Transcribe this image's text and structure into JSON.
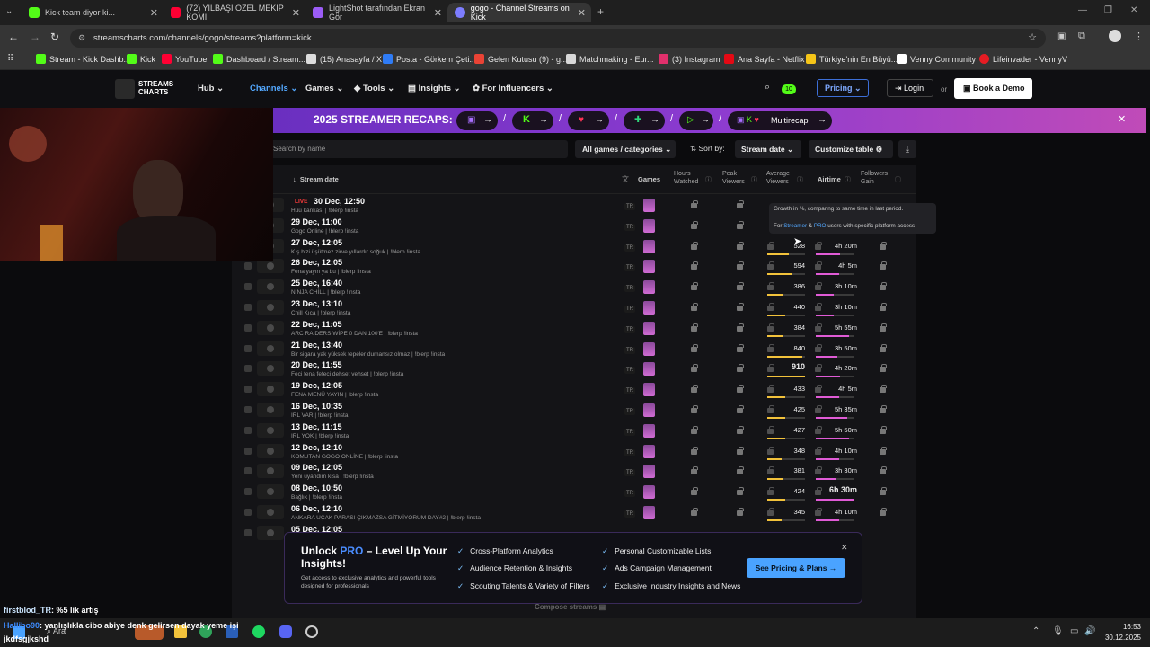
{
  "browser": {
    "tabs": [
      {
        "title": "Kick team diyor ki...",
        "color": "#53fc18"
      },
      {
        "title": "(72) YILBAŞI ÖZEL MEKİP KOMİ",
        "color": "#ff0033"
      },
      {
        "title": "LightShot tarafından Ekran Gör",
        "color": "#9b5cf6"
      },
      {
        "title": "gogo - Channel Streams on Kick",
        "color": "#7d7dff"
      }
    ],
    "url": "streamscharts.com/channels/gogo/streams?platform=kick",
    "bookmarks": [
      {
        "label": "Stream - Kick Dashb...",
        "color": "#53fc18"
      },
      {
        "label": "Kick",
        "color": "#53fc18"
      },
      {
        "label": "YouTube",
        "color": "#ff0033"
      },
      {
        "label": "Dashboard / Stream...",
        "color": "#53fc18"
      },
      {
        "label": "(15) Anasayfa / X",
        "color": "#dddddd"
      },
      {
        "label": "Posta - Görkem Çeti...",
        "color": "#2f7cf6"
      },
      {
        "label": "Gelen Kutusu (9) - g...",
        "color": "#ea4335"
      },
      {
        "label": "Matchmaking - Eur...",
        "color": "#d8d8d8"
      },
      {
        "label": "(3) Instagram",
        "color": "#e1306c"
      },
      {
        "label": "Ana Sayfa - Netflix",
        "color": "#e50914"
      },
      {
        "label": "Türkiye'nin En Büyü...",
        "color": "#f5c518"
      },
      {
        "label": "Venny Community",
        "color": "#ffffff"
      },
      {
        "label": "Lifeinvader - VennyV",
        "color": "#e51c23"
      }
    ]
  },
  "site": {
    "logo": "STREAMS CHARTS",
    "nav": [
      "Hub",
      "Channels",
      "Games",
      "Tools",
      "Insights",
      "For Influencers"
    ],
    "badge": "10",
    "pricing": "Pricing",
    "login": "Login",
    "or": "or",
    "demo": "Book a Demo"
  },
  "banner": {
    "title": "2025 STREAMER RECAPS:",
    "multicap": "Multirecap"
  },
  "filters": {
    "search_placeholder": "Search by name",
    "games": "All games / categories",
    "sort_label": "Sort by:",
    "sort_value": "Stream date",
    "customize": "Customize table"
  },
  "columns": {
    "date": "Stream date",
    "games": "Games",
    "hours": "Hours Watched",
    "peak": "Peak Viewers",
    "avg": "Average Viewers",
    "airtime": "Airtime",
    "followers": "Followers Gain"
  },
  "tooltip": {
    "line1": "Growth in %, comparing to same time in last period.",
    "line2_pre": "For",
    "line2_streamer": "Streamer",
    "line2_amp": "&",
    "line2_pro": "PRO",
    "line2_post": "users with specific platform access"
  },
  "live_label": "LIVE",
  "streams": [
    {
      "date": "30 Dec, 12:50",
      "title": "Hüü kankası | !blerp !insta",
      "avg": "",
      "air": "",
      "avg_pct": 0,
      "air_pct": 0
    },
    {
      "date": "29 Dec, 11:00",
      "title": "Gogo Online | !blerp !insta",
      "avg": "",
      "air": "",
      "avg_pct": 0,
      "air_pct": 0
    },
    {
      "date": "27 Dec, 12:05",
      "title": "Kış bizi üşütmez zirve yıllardır soğuk | !blerp !insta",
      "avg": "528",
      "air": "4h 20m",
      "avg_pct": 58,
      "air_pct": 65
    },
    {
      "date": "26 Dec, 12:05",
      "title": "Fena yayın ya bu | !blerp !insta",
      "avg": "594",
      "air": "4h 5m",
      "avg_pct": 65,
      "air_pct": 61
    },
    {
      "date": "25 Dec, 16:40",
      "title": "NİNJA CHİLL | !blerp !insta",
      "avg": "386",
      "air": "3h 10m",
      "avg_pct": 42,
      "air_pct": 47
    },
    {
      "date": "23 Dec, 13:10",
      "title": "Chill Kıca | !blerp !insta",
      "avg": "440",
      "air": "3h 10m",
      "avg_pct": 48,
      "air_pct": 47
    },
    {
      "date": "22 Dec, 11:05",
      "title": "ARC RAİDERS WİPE 0 DAN 100'E | !blerp !insta",
      "avg": "384",
      "air": "5h 55m",
      "avg_pct": 42,
      "air_pct": 89
    },
    {
      "date": "21 Dec, 13:40",
      "title": "Bir sigara yak yüksek tepeler dumansız olmaz | !blerp !insta",
      "avg": "840",
      "air": "3h 50m",
      "avg_pct": 92,
      "air_pct": 58
    },
    {
      "date": "20 Dec, 11:55",
      "title": "Feci fena fefeci dehset vehset | !blerp !insta",
      "avg": "910",
      "air": "4h 20m",
      "avg_pct": 100,
      "air_pct": 65
    },
    {
      "date": "19 Dec, 12:05",
      "title": "FENA MENÜ YAYIN | !blerp !insta",
      "avg": "433",
      "air": "4h 5m",
      "avg_pct": 48,
      "air_pct": 61
    },
    {
      "date": "16 Dec, 10:35",
      "title": "IRL VAR | !blerp !insta",
      "avg": "425",
      "air": "5h 35m",
      "avg_pct": 47,
      "air_pct": 84
    },
    {
      "date": "13 Dec, 11:15",
      "title": "IRL YOK | !blerp !insta",
      "avg": "427",
      "air": "5h 50m",
      "avg_pct": 47,
      "air_pct": 88
    },
    {
      "date": "12 Dec, 12:10",
      "title": "KOMUTAN GOGO ONLİNE | !blerp !insta",
      "avg": "348",
      "air": "4h 10m",
      "avg_pct": 38,
      "air_pct": 63
    },
    {
      "date": "09 Dec, 12:05",
      "title": "Yeni uyandım kısa | !blerp !insta",
      "avg": "381",
      "air": "3h 30m",
      "avg_pct": 42,
      "air_pct": 53
    },
    {
      "date": "08 Dec, 10:50",
      "title": "Bağlık | !blerp !insta",
      "avg": "424",
      "air": "6h 30m",
      "avg_pct": 47,
      "air_pct": 100
    },
    {
      "date": "06 Dec, 12:10",
      "title": "ANKARA UÇAK PARASI ÇIKMAZSA GİTMİYORUM DAY#2 | !blerp !insta",
      "avg": "345",
      "air": "4h 10m",
      "avg_pct": 38,
      "air_pct": 63
    },
    {
      "date": "05 Dec, 12:05",
      "title": "",
      "avg": "",
      "air": "",
      "avg_pct": 0,
      "air_pct": 0
    }
  ],
  "promo": {
    "title_a": "Unlock",
    "title_pro": "PRO",
    "title_b": "– Level Up Your Insights!",
    "sub": "Get access to exclusive analytics and powerful tools designed for professionals",
    "features": [
      "Cross-Platform Analytics",
      "Personal Customizable Lists",
      "Audience Retention & Insights",
      "Ads Campaign Management",
      "Scouting Talents & Variety of Filters",
      "Exclusive Industry Insights and News"
    ],
    "cta": "See Pricing & Plans"
  },
  "compose": "Compose streams",
  "chat": [
    {
      "user": "firstblod_TR",
      "msg": ": %5 lik artış"
    },
    {
      "user": "Hallibo90",
      "msg": ": yanlışlıkla cibo abiye denk gelirsen dayak yeme işi"
    },
    {
      "user": "jkdfsgjkshd",
      "msg": ""
    }
  ],
  "taskbar": {
    "search": "Ara",
    "time": "16:53",
    "date": "30.12.2025"
  }
}
